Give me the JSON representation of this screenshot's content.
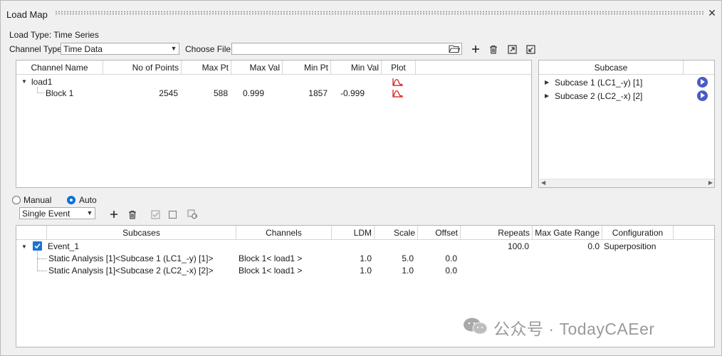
{
  "window": {
    "title": "Load Map"
  },
  "load_type_label": "Load Type: Time Series",
  "channel_type": {
    "label": "Channel Type:",
    "value": "Time Data"
  },
  "choose_file": {
    "label": "Choose File:",
    "value": ""
  },
  "channel_table": {
    "headers": [
      "Channel Name",
      "No of Points",
      "Max Pt",
      "Max Val",
      "Min Pt",
      "Min Val",
      "Plot"
    ],
    "group": "load1",
    "rows": [
      {
        "name": "Block 1",
        "points": "2545",
        "max_pt": "588",
        "max_val": "0.999",
        "min_pt": "1857",
        "min_val": "-0.999"
      }
    ]
  },
  "subcase_panel": {
    "header": "Subcase",
    "items": [
      {
        "label": "Subcase 1 (LC1_-y) [1]"
      },
      {
        "label": "Subcase 2 (LC2_-x) [2]"
      }
    ]
  },
  "mode": {
    "manual": "Manual",
    "auto": "Auto",
    "selected": "Auto"
  },
  "event_type": {
    "value": "Single Event"
  },
  "event_table": {
    "headers": [
      "Subcases",
      "Channels",
      "LDM",
      "Scale",
      "Offset",
      "Repeats",
      "Max Gate Range",
      "Configuration"
    ],
    "event": {
      "name": "Event_1",
      "repeats": "100.0",
      "max_gate_range": "0.0",
      "configuration": "Superposition"
    },
    "rows": [
      {
        "subcase": "Static Analysis [1]<Subcase 1 (LC1_-y) [1]>",
        "channel": "Block 1< load1 >",
        "ldm": "1.0",
        "scale": "5.0",
        "offset": "0.0"
      },
      {
        "subcase": "Static Analysis [1]<Subcase 2 (LC2_-x) [2]>",
        "channel": "Block 1< load1 >",
        "ldm": "1.0",
        "scale": "1.0",
        "offset": "0.0"
      }
    ]
  },
  "watermark": "公众号 · TodayCAEer",
  "colors": {
    "accent": "#1b73d3",
    "play": "#4a5bc4",
    "plot_icon": "#d01010"
  },
  "icons": [
    "close-icon",
    "chevron-down-icon",
    "folder-icon",
    "plus-icon",
    "trash-icon",
    "export-icon",
    "import-icon",
    "plot-icon",
    "play-icon",
    "check-icon",
    "checkbox-icon",
    "refresh-icon",
    "wechat-icon"
  ]
}
